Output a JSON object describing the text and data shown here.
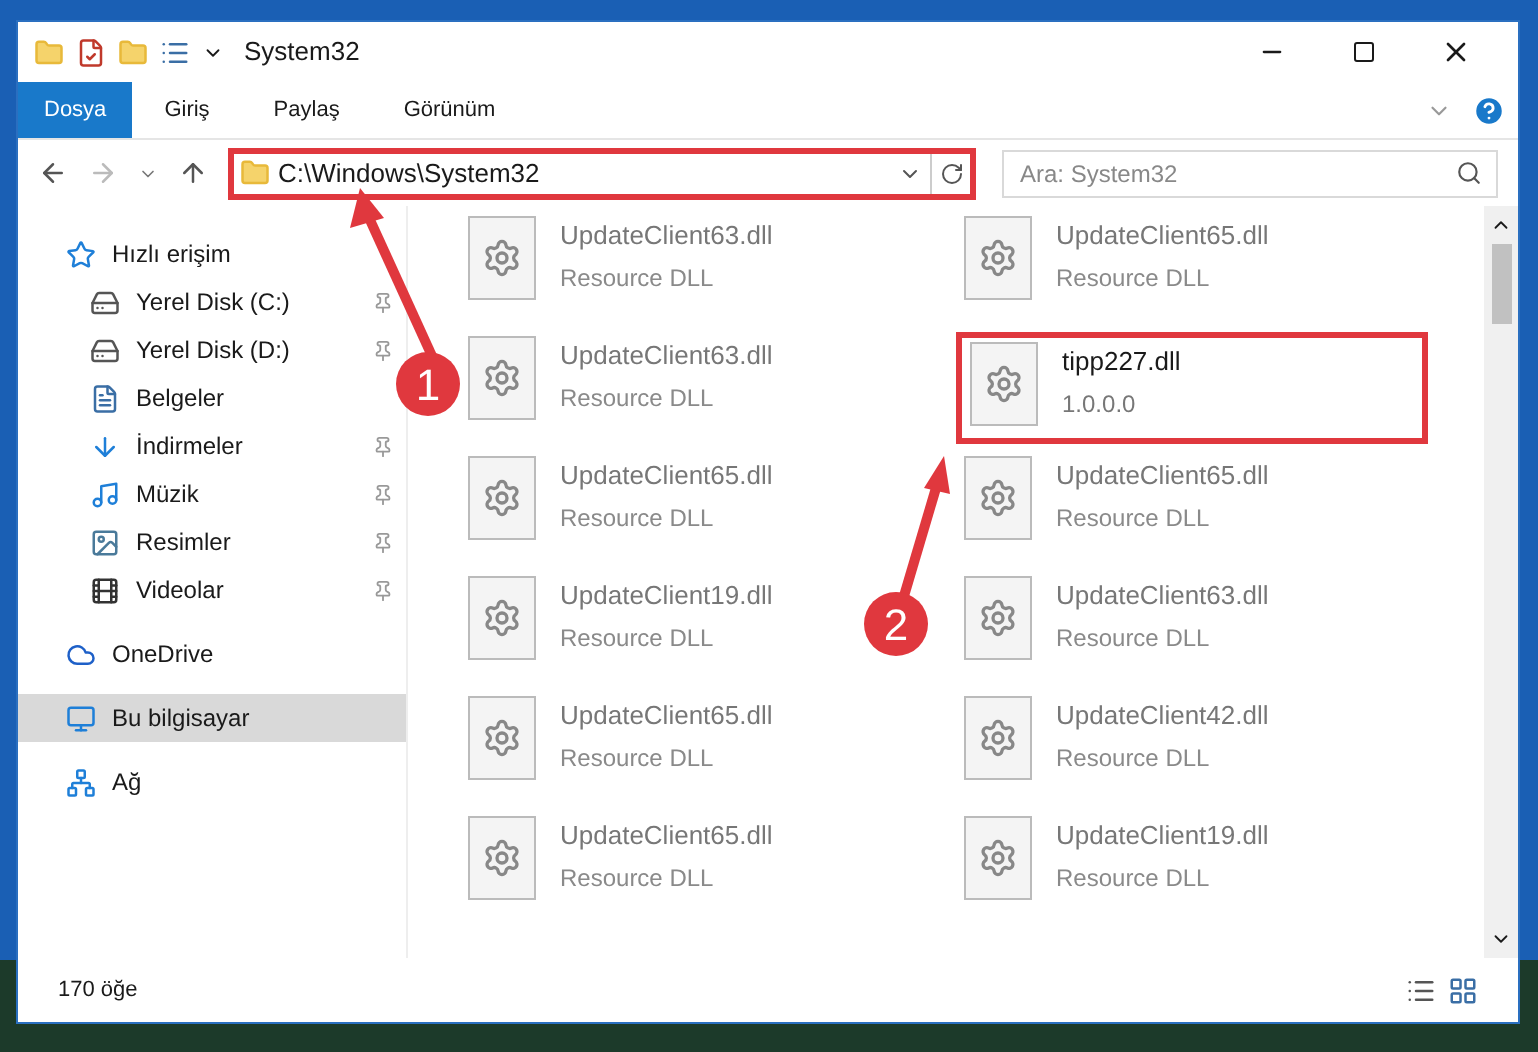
{
  "window": {
    "title": "System32"
  },
  "ribbon_tabs": [
    {
      "label": "Dosya",
      "selected": true
    },
    {
      "label": "Giriş",
      "selected": false
    },
    {
      "label": "Paylaş",
      "selected": false
    },
    {
      "label": "Görünüm",
      "selected": false
    }
  ],
  "address_bar": {
    "path": "C:\\Windows\\System32",
    "highlighted": true
  },
  "search": {
    "placeholder": "Ara: System32"
  },
  "sidebar": {
    "items": [
      {
        "label": "Hızlı erişim",
        "kind": "star",
        "pinned": false,
        "selected": false,
        "children": [
          {
            "label": "Yerel Disk (C:)",
            "kind": "disk-c",
            "pinned": true,
            "selected": false
          },
          {
            "label": "Yerel Disk (D:)",
            "kind": "disk",
            "pinned": true,
            "selected": false
          },
          {
            "label": "Belgeler",
            "kind": "docs",
            "pinned": false,
            "selected": false
          },
          {
            "label": "İndirmeler",
            "kind": "download",
            "pinned": true,
            "selected": false
          },
          {
            "label": "Müzik",
            "kind": "music",
            "pinned": true,
            "selected": false
          },
          {
            "label": "Resimler",
            "kind": "pictures",
            "pinned": true,
            "selected": false
          },
          {
            "label": "Videolar",
            "kind": "videos",
            "pinned": true,
            "selected": false
          }
        ]
      },
      {
        "label": "OneDrive",
        "kind": "cloud",
        "pinned": false,
        "selected": false
      },
      {
        "label": "Bu bilgisayar",
        "kind": "pc",
        "pinned": false,
        "selected": true
      },
      {
        "label": "Ağ",
        "kind": "network",
        "pinned": false,
        "selected": false
      }
    ]
  },
  "files": [
    {
      "name": "UpdateClient63.dll",
      "subtitle": "Resource DLL",
      "highlighted": false
    },
    {
      "name": "UpdateClient65.dll",
      "subtitle": "Resource DLL",
      "highlighted": false
    },
    {
      "name": "UpdateClient63.dll",
      "subtitle": "Resource DLL",
      "highlighted": false
    },
    {
      "name": "tipp227.dll",
      "subtitle": "1.0.0.0",
      "highlighted": true
    },
    {
      "name": "UpdateClient65.dll",
      "subtitle": "Resource DLL",
      "highlighted": false
    },
    {
      "name": "UpdateClient65.dll",
      "subtitle": "Resource DLL",
      "highlighted": false
    },
    {
      "name": "UpdateClient19.dll",
      "subtitle": "Resource DLL",
      "highlighted": false
    },
    {
      "name": "UpdateClient63.dll",
      "subtitle": "Resource DLL",
      "highlighted": false
    },
    {
      "name": "UpdateClient65.dll",
      "subtitle": "Resource DLL",
      "highlighted": false
    },
    {
      "name": "UpdateClient42.dll",
      "subtitle": "Resource DLL",
      "highlighted": false
    },
    {
      "name": "UpdateClient65.dll",
      "subtitle": "Resource DLL",
      "highlighted": false
    },
    {
      "name": "UpdateClient19.dll",
      "subtitle": "Resource DLL",
      "highlighted": false
    }
  ],
  "status_bar": {
    "count": "170 öğe"
  },
  "annotations": [
    {
      "number": "1"
    },
    {
      "number": "2"
    }
  ]
}
